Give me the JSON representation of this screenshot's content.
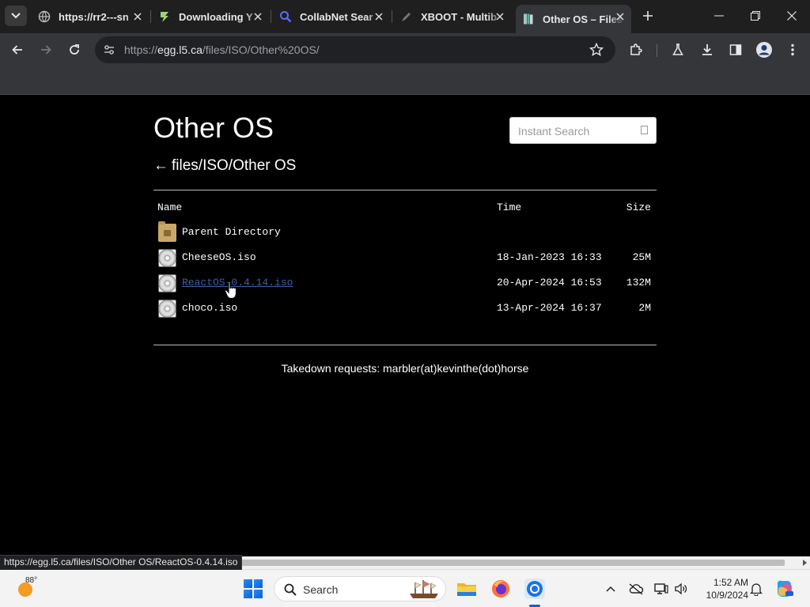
{
  "browser": {
    "tabs": [
      {
        "title": "https://rr2---sn",
        "icon": "globe-icon"
      },
      {
        "title": "Downloading Y",
        "icon": "bolt-icon"
      },
      {
        "title": "CollabNet Sear",
        "icon": "magnifier-icon"
      },
      {
        "title": "XBOOT - Multib",
        "icon": "pen-icon"
      },
      {
        "title": "Other OS – Files",
        "icon": "book-icon",
        "active": true
      }
    ],
    "url_prefix": "https://",
    "url_host": "egg.l5.ca",
    "url_path": "/files/ISO/Other%20OS/"
  },
  "page": {
    "title": "Other OS",
    "search_placeholder": "Instant Search",
    "breadcrumb_arrow": "←",
    "breadcrumb_path": "files/ISO/Other OS",
    "columns": {
      "name": "Name",
      "time": "Time",
      "size": "Size"
    },
    "rows": [
      {
        "name": "Parent Directory",
        "time": "",
        "size": "",
        "icon": "folder-icon"
      },
      {
        "name": "CheeseOS.iso",
        "time": "18-Jan-2023 16:33",
        "size": "25M",
        "icon": "disc-icon"
      },
      {
        "name": "ReactOS-0.4.14.iso",
        "time": "20-Apr-2024 16:53",
        "size": "132M",
        "icon": "disc-icon",
        "hover": true
      },
      {
        "name": "choco.iso",
        "time": "13-Apr-2024 16:37",
        "size": "2M",
        "icon": "disc-icon"
      }
    ],
    "footer": "Takedown requests: marbler(at)kevinthe(dot)horse"
  },
  "status_url": "https://egg.l5.ca/files/ISO/Other OS/ReactOS-0.4.14.iso",
  "taskbar": {
    "temperature": "88°",
    "search_label": "Search",
    "time": "1:52 AM",
    "date": "10/9/2024"
  },
  "colors": {
    "page_bg": "#000000",
    "link_hover": "#3a5fa8",
    "chrome_dark": "#1f1f1f",
    "toolbar": "#35363a"
  }
}
